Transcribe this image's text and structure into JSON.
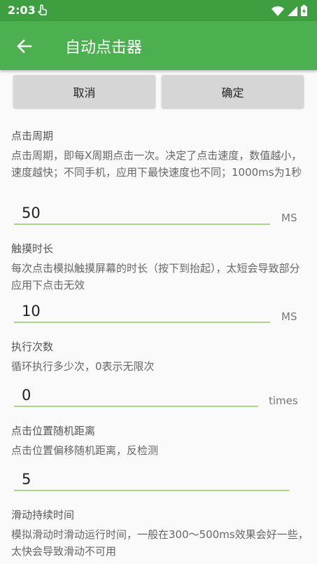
{
  "status_bar": {
    "time": "2:03",
    "icons": [
      "touch-icon",
      "wifi-icon",
      "signal-icon",
      "battery-charging-icon"
    ]
  },
  "app_bar": {
    "title": "自动点击器",
    "back_icon": "arrow-left-icon"
  },
  "buttons": {
    "cancel": "取消",
    "ok": "确定"
  },
  "settings": [
    {
      "title": "点击周期",
      "description": "点击周期，即每X周期点击一次。决定了点击速度，数值越小，速度越快；不同手机，应用下最快速度也不同；1000ms为1秒",
      "value": "50",
      "unit": "MS"
    },
    {
      "title": "触摸时长",
      "description": "每次点击模拟触摸屏幕的时长（按下到抬起），太短会导致部分应用下点击无效",
      "value": "10",
      "unit": "MS"
    },
    {
      "title": "执行次数",
      "description": "循环执行多少次，0表示无限次",
      "value": "0",
      "unit": "times"
    },
    {
      "title": "点击位置随机距离",
      "description": "点击位置偏移随机距离，反检测",
      "value": "5",
      "unit": ""
    },
    {
      "title": "滑动持续时间",
      "description": "模拟滑动时滑动运行时间，一般在300～500ms效果会好一些，太快会导致滑动不可用"
    }
  ],
  "colors": {
    "status_bar": "#3d9f40",
    "app_bar": "#4caf50",
    "button": "#d6d6d6",
    "underline": "#a8d58a"
  }
}
